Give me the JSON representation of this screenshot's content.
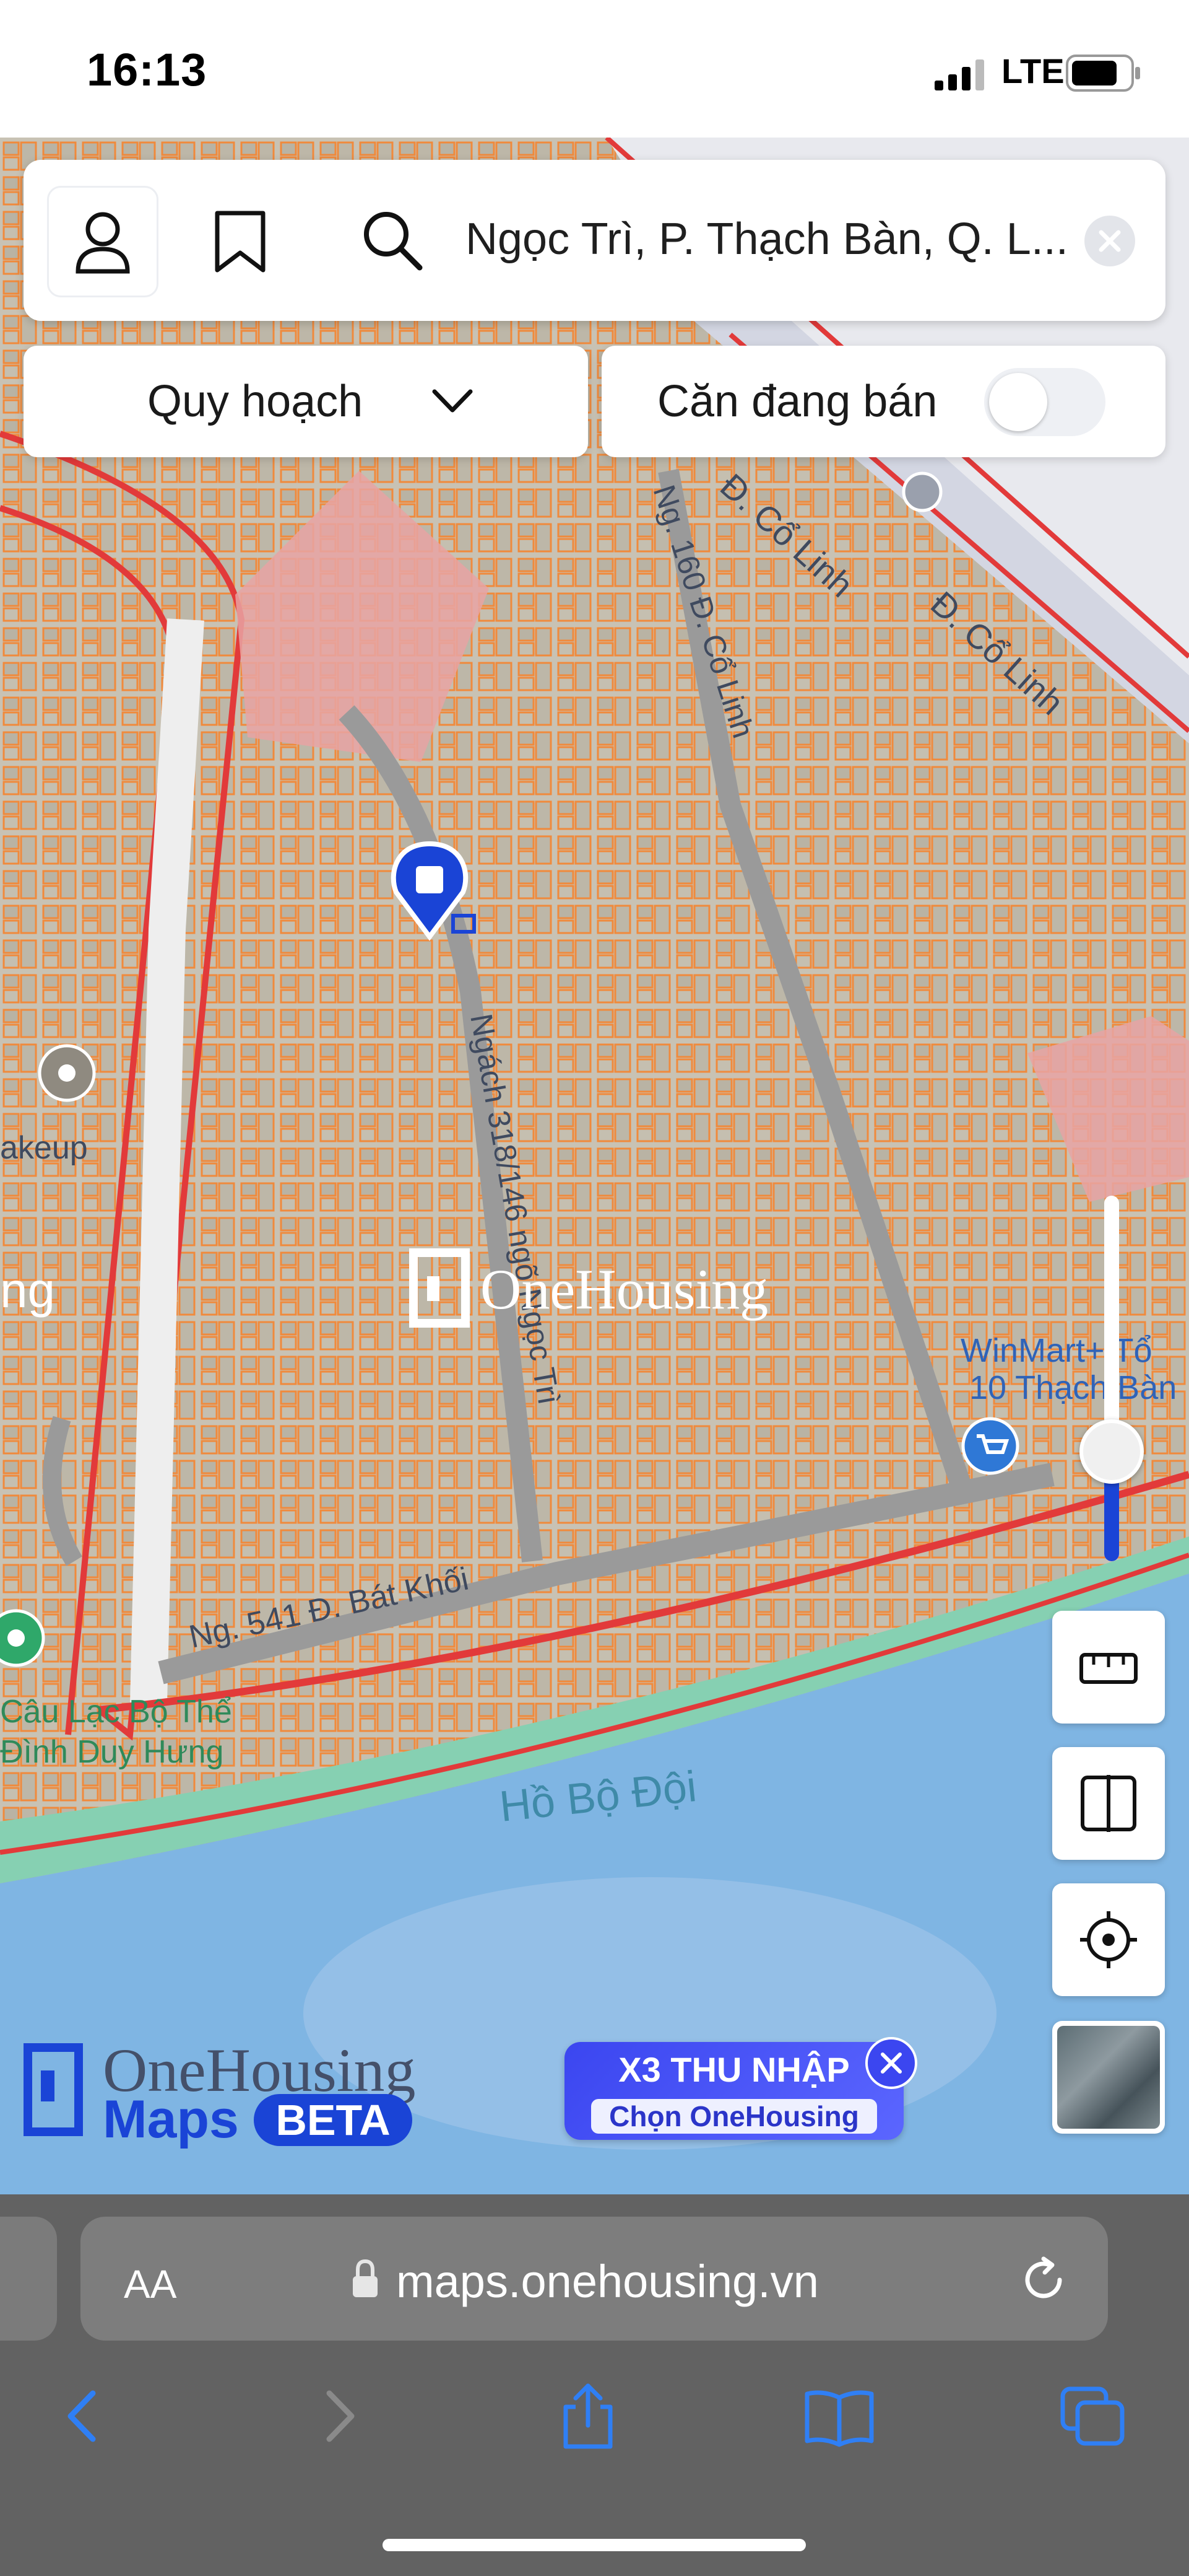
{
  "status_bar": {
    "time": "16:13",
    "network": "LTE",
    "battery_level": 0.8
  },
  "search": {
    "value": "Ngọc Trì, P. Thạch Bàn, Q. L..."
  },
  "filters": {
    "planning_label": "Quy hoạch",
    "for_sale_label": "Căn đang bán",
    "for_sale_enabled": false
  },
  "map": {
    "streets": [
      "Đ. Cổ Linh",
      "Đ. Cổ Linh",
      "Ng. 160 Đ. Cổ Linh",
      "Ngách 318/146 ngõ Ngọc Trì",
      "Ng. 541 Đ. Bát Khối"
    ],
    "places": [
      "akeup",
      "ng",
      "Câu Lạc Bộ Thể",
      "Đình Duy Hưng",
      "WinMart+ Tổ",
      "10 Thạch Bàn"
    ],
    "lake": "Hồ Bộ Đội",
    "watermark": "OneHousing",
    "zoom_level": 0.3
  },
  "brand": {
    "line1": "OneHousing",
    "line2": "Maps",
    "badge": "BETA"
  },
  "promo": {
    "title": "X3 THU NHẬP",
    "subtitle": "Chọn OneHousing"
  },
  "browser": {
    "text_size": "AA",
    "url": "maps.onehousing.vn"
  },
  "colors": {
    "accent": "#1a44d6",
    "plan_boundary": "#e23a3a",
    "parcel": "#f08a3c",
    "water": "#6aa6d8"
  }
}
